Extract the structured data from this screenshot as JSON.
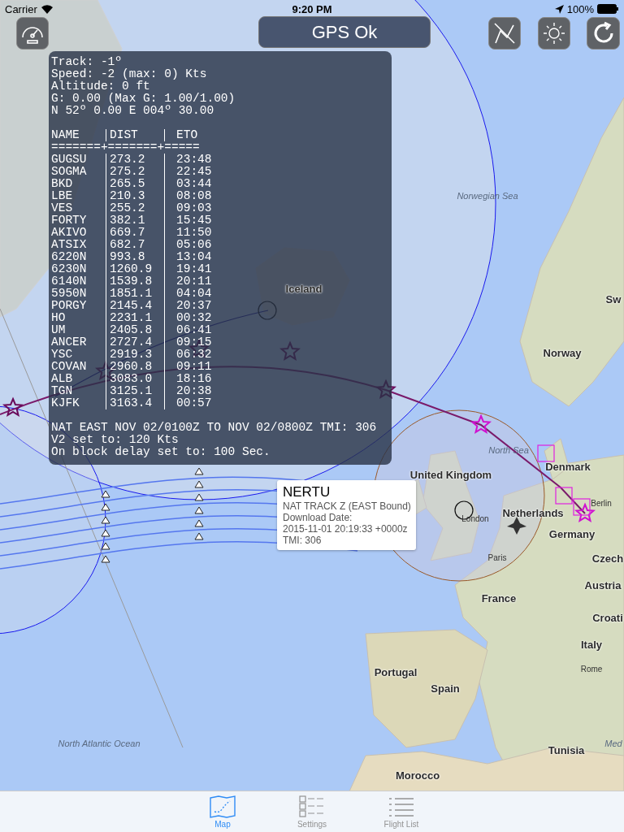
{
  "status_bar": {
    "carrier": "Carrier",
    "time": "9:20 PM",
    "battery": "100%"
  },
  "gps_status": "GPS Ok",
  "info_panel": {
    "lines": [
      "Track: -1º",
      "Speed: -2 (max: 0) Kts",
      "Altitude: 0 ft",
      "G: 0.00 (Max G: 1.00/1.00)",
      "N 52º 0.00 E 004º 30.00"
    ],
    "table": {
      "columns": [
        "NAME",
        "DIST",
        "ETO"
      ],
      "separator": "=======+=======+=====",
      "rows": [
        {
          "name": "GUGSU",
          "dist": "273.2",
          "eto": "23:48"
        },
        {
          "name": "SOGMA",
          "dist": "275.2",
          "eto": "22:45"
        },
        {
          "name": "BKD",
          "dist": "265.5",
          "eto": "03:44"
        },
        {
          "name": "LBE",
          "dist": "210.3",
          "eto": "08:08"
        },
        {
          "name": "VES",
          "dist": "255.2",
          "eto": "09:03"
        },
        {
          "name": "FORTY",
          "dist": "382.1",
          "eto": "15:45"
        },
        {
          "name": "AKIVO",
          "dist": "669.7",
          "eto": "11:50"
        },
        {
          "name": "ATSIX",
          "dist": "682.7",
          "eto": "05:06"
        },
        {
          "name": "6220N",
          "dist": "993.8",
          "eto": "13:04"
        },
        {
          "name": "6230N",
          "dist": "1260.9",
          "eto": "19:41"
        },
        {
          "name": "6140N",
          "dist": "1539.8",
          "eto": "20:11"
        },
        {
          "name": "5950N",
          "dist": "1851.1",
          "eto": "04:04"
        },
        {
          "name": "PORGY",
          "dist": "2145.4",
          "eto": "20:37"
        },
        {
          "name": "HO",
          "dist": "2231.1",
          "eto": "00:32"
        },
        {
          "name": "UM",
          "dist": "2405.8",
          "eto": "06:41"
        },
        {
          "name": "ANCER",
          "dist": "2727.4",
          "eto": "09:15"
        },
        {
          "name": "YSC",
          "dist": "2919.3",
          "eto": "06:32"
        },
        {
          "name": "COVAN",
          "dist": "2960.8",
          "eto": "09:11"
        },
        {
          "name": "ALB",
          "dist": "3083.0",
          "eto": "18:16"
        },
        {
          "name": "TGN",
          "dist": "3125.1",
          "eto": "20:38"
        },
        {
          "name": "KJFK",
          "dist": "3163.4",
          "eto": "00:57"
        }
      ]
    },
    "footer": [
      "NAT EAST NOV 02/0100Z TO NOV 02/0800Z TMI: 306",
      "V2 set to: 120 Kts",
      "On block delay set to: 100 Sec."
    ]
  },
  "callout": {
    "title": "NERTU",
    "lines": [
      "NAT TRACK Z (EAST Bound)",
      "Download Date:",
      "2015-11-01 20:19:33 +0000z",
      "TMI: 306"
    ]
  },
  "map_labels": [
    {
      "text": "Norwegian Sea",
      "kind": "water"
    },
    {
      "text": "Iceland",
      "kind": "country"
    },
    {
      "text": "Sw",
      "kind": "country"
    },
    {
      "text": "Norway",
      "kind": "country"
    },
    {
      "text": "North Sea",
      "kind": "water"
    },
    {
      "text": "Denmark",
      "kind": "country"
    },
    {
      "text": "United Kingdom",
      "kind": "country"
    },
    {
      "text": "Berlin",
      "kind": "city"
    },
    {
      "text": "Netherlands",
      "kind": "country"
    },
    {
      "text": "London",
      "kind": "city"
    },
    {
      "text": "Germany",
      "kind": "country"
    },
    {
      "text": "Paris",
      "kind": "city"
    },
    {
      "text": "Czech",
      "kind": "country"
    },
    {
      "text": "Austria",
      "kind": "country"
    },
    {
      "text": "France",
      "kind": "country"
    },
    {
      "text": "Croati",
      "kind": "country"
    },
    {
      "text": "Italy",
      "kind": "country"
    },
    {
      "text": "Portugal",
      "kind": "country"
    },
    {
      "text": "Rome",
      "kind": "city"
    },
    {
      "text": "Spain",
      "kind": "country"
    },
    {
      "text": "North Atlantic Ocean",
      "kind": "water"
    },
    {
      "text": "Med",
      "kind": "water"
    },
    {
      "text": "Tunisia",
      "kind": "country"
    },
    {
      "text": "Morocco",
      "kind": "country"
    }
  ],
  "tabs": [
    {
      "label": "Map",
      "selected": true
    },
    {
      "label": "Settings",
      "selected": false
    },
    {
      "label": "Flight List",
      "selected": false
    }
  ]
}
